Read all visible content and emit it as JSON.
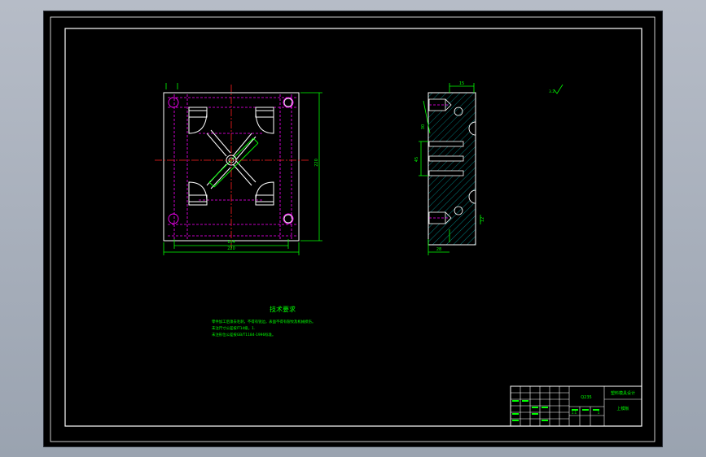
{
  "drawing": {
    "notes_title": "技术要求",
    "notes": [
      "零件加工后须去毛刺，不得有锐边，表面不得有裂纹及机械损伤。",
      "未注尺寸公差按IT14级，1.",
      "未注形位公差按GB/T1184-1996标准。"
    ],
    "plan_view": {
      "dim_bottom_inner": "104",
      "dim_bottom_outer": "220",
      "dim_right": "220"
    },
    "section_view": {
      "dim_top": "15",
      "dim_left": "30",
      "dim_mid": "45",
      "dim_right_bottom": "12",
      "dim_bottom": "28"
    },
    "roughness_symbol": "3.2",
    "title_block": {
      "material": "Q235",
      "title_line1": "塑料模具设计",
      "part_name": "上模板",
      "scale": "1:1",
      "sheet": "1"
    }
  }
}
